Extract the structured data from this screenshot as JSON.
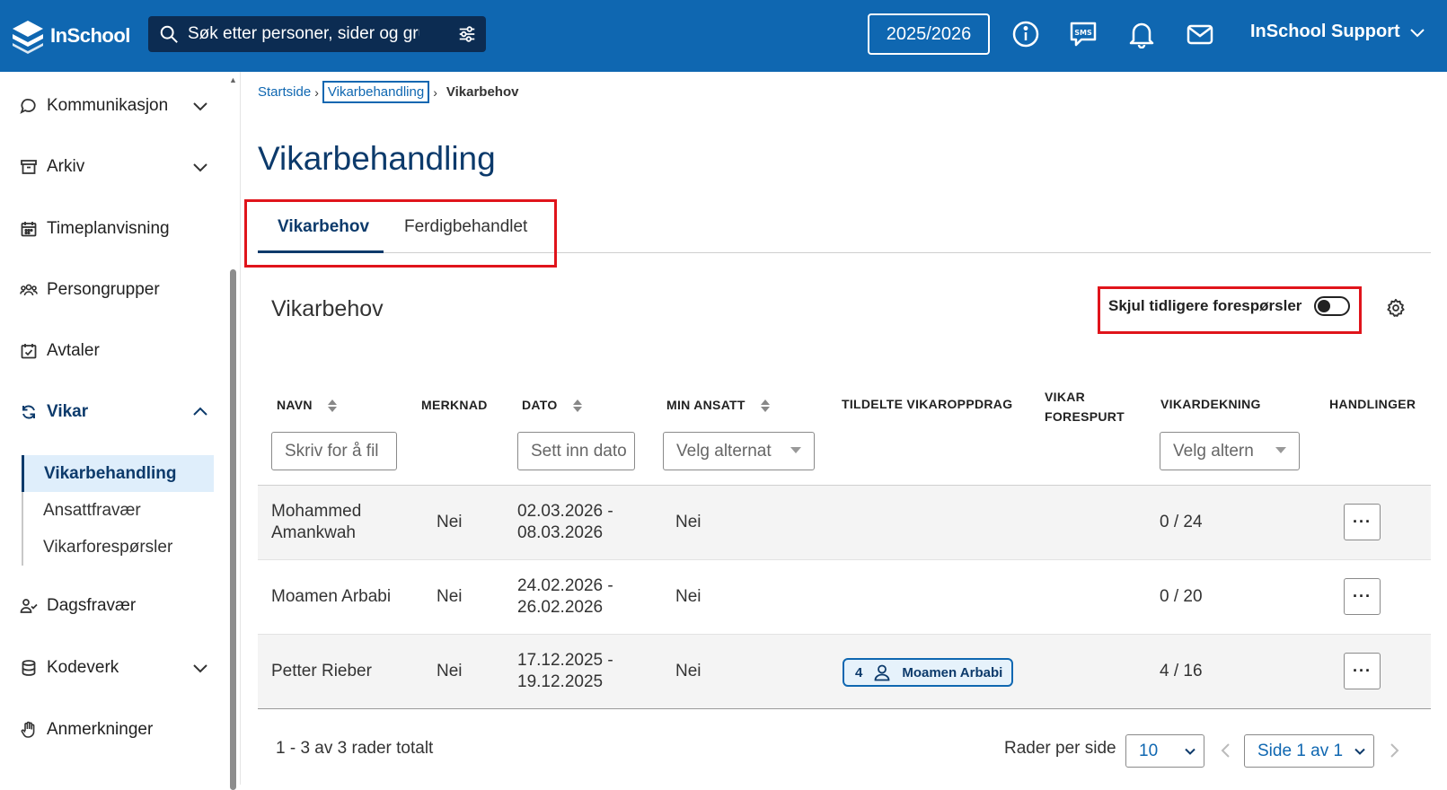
{
  "header": {
    "logo_text": "InSchool",
    "search_placeholder": "Søk etter personer, sider og gru",
    "school_year": "2025/2026",
    "user_name": "InSchool Support",
    "icons": [
      "info-icon",
      "sms-icon",
      "bell-icon",
      "mail-icon"
    ]
  },
  "sidebar": {
    "items": [
      {
        "label": "Kommunikasjon",
        "icon": "chat-icon",
        "expandable": true
      },
      {
        "label": "Arkiv",
        "icon": "archive-icon",
        "expandable": true
      },
      {
        "label": "Timeplanvisning",
        "icon": "calendar-icon",
        "expandable": false
      },
      {
        "label": "Persongrupper",
        "icon": "people-icon",
        "expandable": false
      },
      {
        "label": "Avtaler",
        "icon": "calendar-check-icon",
        "expandable": false
      },
      {
        "label": "Vikar",
        "icon": "refresh-icon",
        "expandable": true,
        "expanded": true
      },
      {
        "label": "Dagsfravær",
        "icon": "person-check-icon",
        "expandable": false
      },
      {
        "label": "Kodeverk",
        "icon": "database-icon",
        "expandable": true
      },
      {
        "label": "Anmerkninger",
        "icon": "hand-icon",
        "expandable": false
      }
    ],
    "vikar_sub": [
      {
        "label": "Vikarbehandling",
        "active": true
      },
      {
        "label": "Ansattfravær",
        "active": false
      },
      {
        "label": "Vikarforespørsler",
        "active": false
      }
    ]
  },
  "breadcrumb": {
    "home": "Startside",
    "parent": "Vikarbehandling",
    "current": "Vikarbehov"
  },
  "page": {
    "title": "Vikarbehandling",
    "tabs": [
      {
        "label": "Vikarbehov",
        "active": true
      },
      {
        "label": "Ferdigbehandlet",
        "active": false
      }
    ],
    "section_title": "Vikarbehov",
    "toggle_label": "Skjul tidligere forespørsler",
    "toggle_on": false
  },
  "table": {
    "headers": {
      "navn": "NAVN",
      "merknad": "MERKNAD",
      "dato": "DATO",
      "min_ansatt": "MIN ANSATT",
      "tildelte": "TILDELTE VIKAROPPDRAG",
      "vikar_forespurt_1": "VIKAR",
      "vikar_forespurt_2": "FORESPURT",
      "vikardekning": "VIKARDEKNING",
      "handlinger": "HANDLINGER"
    },
    "filters": {
      "navn": "Skriv for å fil",
      "dato": "Sett inn dato",
      "min_ansatt": "Velg alternat",
      "vikardekning": "Velg altern"
    },
    "rows": [
      {
        "name_1": "Mohammed",
        "name_2": "Amankwah",
        "merknad": "Nei",
        "date_1": "02.03.2026 -",
        "date_2": "08.03.2026",
        "min_ansatt": "Nei",
        "dekning": "0 / 24",
        "action": "···"
      },
      {
        "name_1": "Moamen Arbabi",
        "name_2": "",
        "merknad": "Nei",
        "date_1": "24.02.2026 -",
        "date_2": "26.02.2026",
        "min_ansatt": "Nei",
        "dekning": "0 / 20",
        "action": "···"
      },
      {
        "name_1": "Petter Rieber",
        "name_2": "",
        "merknad": "Nei",
        "date_1": "17.12.2025 -",
        "date_2": "19.12.2025",
        "min_ansatt": "Nei",
        "dekning": "4 / 16",
        "action": "···",
        "chip_count": "4",
        "chip_name": "Moamen Arbabi"
      }
    ]
  },
  "footer": {
    "count_text": "1 - 3 av 3 rader totalt",
    "rows_per_page_label": "Rader per side",
    "rows_per_page_value": "10",
    "page_value": "Side 1 av 1"
  },
  "colors": {
    "header_bg": "#0f67b1",
    "search_bg": "#0c2c52",
    "accent_dark": "#0c3a6b",
    "highlight_red": "#e0141b",
    "active_sub_bg": "#dfeefb"
  }
}
